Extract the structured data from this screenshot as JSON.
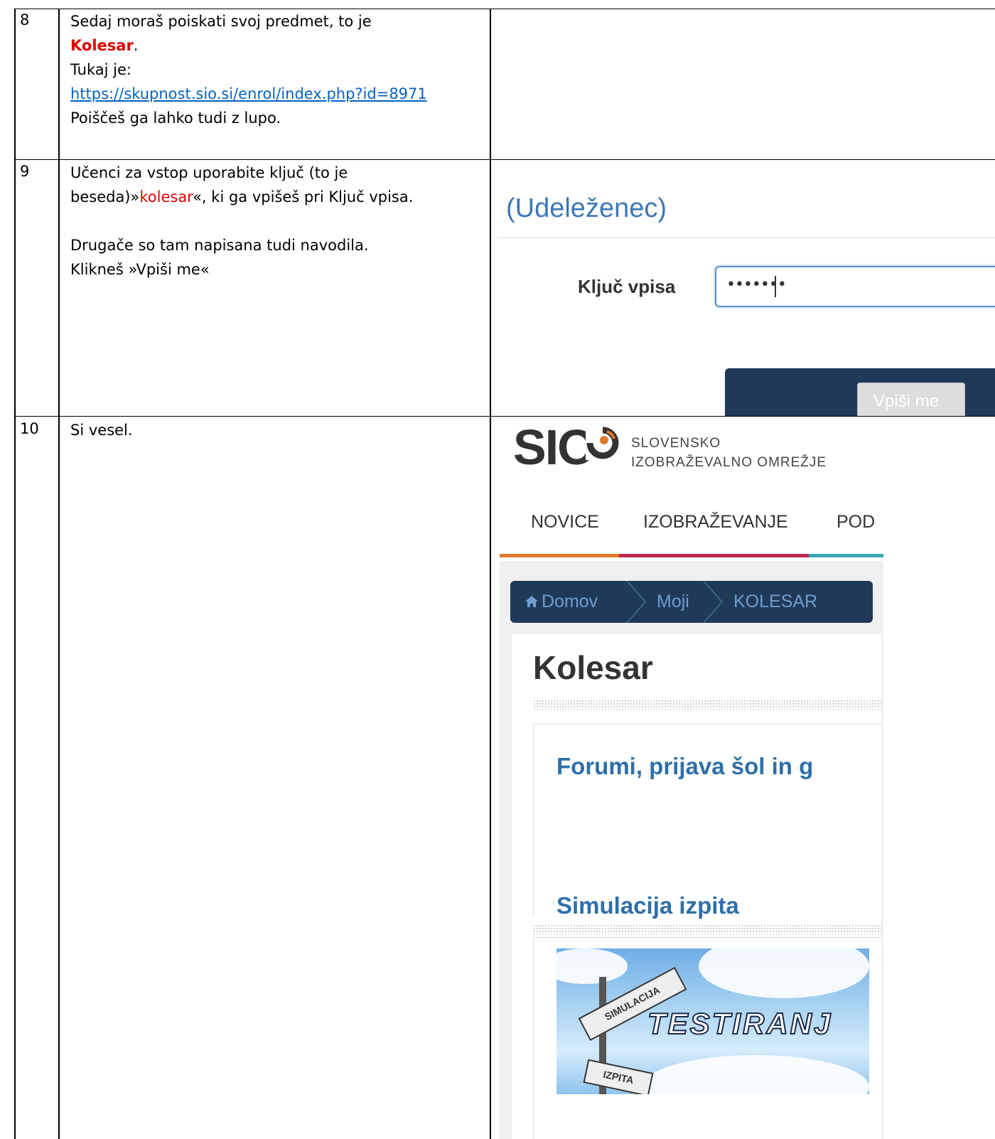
{
  "rows": [
    {
      "number": "8",
      "line1": "Sedaj moraš poiskati svoj predmet, to je",
      "highlight": "Kolesar",
      "after_highlight": ".",
      "line3": "Tukaj je:",
      "link": "https://skupnost.sio.si/enrol/index.php?id=8971",
      "line5": "Poiščeš ga lahko tudi z lupo."
    },
    {
      "number": "9",
      "line1": "Učenci za vstop uporabite ključ (to je",
      "line2_pre": "beseda)»",
      "highlight": "kolesar",
      "line2_post": "«, ki ga vpišeš pri Ključ vpisa.",
      "line3": "Drugače so tam napisana tudi navodila.",
      "line4": "Klikneš »Vpiši me«"
    },
    {
      "number": "10",
      "line1": "Si vesel."
    }
  ],
  "enrol_screenshot": {
    "role": "(Udeleženec)",
    "key_label": "Ključ vpisa",
    "key_value": "•••••••",
    "button": "Vpiši me"
  },
  "course_screenshot": {
    "logo": "SIO",
    "logo_line1": "SLOVENSKO",
    "logo_line2": "IZOBRAŽEVALNO OMREŽJE",
    "nav": [
      "NOVICE",
      "IZOBRAŽEVANJE",
      "POD"
    ],
    "breadcrumb": [
      "Domov",
      "Moji",
      "KOLESAR"
    ],
    "course_title": "Kolesar",
    "section1": "Forumi, prijava šol in g",
    "section2": "Simulacija izpita",
    "banner_text": "TESTIRANJ",
    "sign1": "SIMULACIJA",
    "sign2": "IZPITA",
    "colors": {
      "nav_orange": "#e07b2a",
      "nav_red": "#c0264a",
      "nav_teal": "#3aa5b8",
      "breadcrumb_bg": "#1f3a58",
      "link_blue": "#2f6fa8"
    }
  }
}
